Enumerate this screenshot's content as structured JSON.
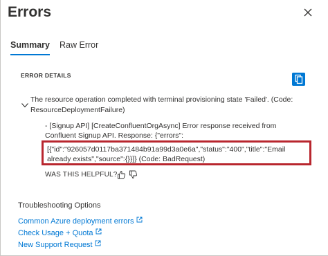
{
  "panel": {
    "title": "Errors"
  },
  "tabs": [
    {
      "label": "Summary",
      "selected": true
    },
    {
      "label": "Raw Error",
      "selected": false
    }
  ],
  "error_details": {
    "section_label": "ERROR DETAILS",
    "message": "The resource operation completed with terminal provisioning state 'Failed'. (Code: ResourceDeploymentFailure)",
    "sub_message": "- [Signup API] [CreateConfluentOrgAsync] Error response received from Confluent Signup API. Response: {\"errors\":",
    "highlighted_message": "[{\"id\":\"926057d0117ba371484b91a99d3a0e6a\",\"status\":\"400\",\"title\":\"Email already exists\",\"source\":{}}]} (Code: BadRequest)"
  },
  "feedback": {
    "question": "WAS THIS HELPFUL?"
  },
  "troubleshooting": {
    "label": "Troubleshooting Options",
    "links": [
      {
        "label": "Common Azure deployment errors"
      },
      {
        "label": "Check Usage + Quota"
      },
      {
        "label": "New Support Request"
      }
    ]
  },
  "colors": {
    "accent": "#0078d4",
    "highlight_border": "#b8262e",
    "text": "#323130"
  },
  "icons": [
    "close-icon",
    "copy-icon",
    "chevron-down-icon",
    "thumbs-up-icon",
    "thumbs-down-icon",
    "external-link-icon"
  ]
}
